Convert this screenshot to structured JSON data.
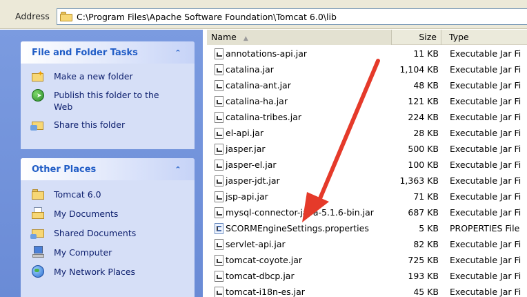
{
  "address_bar": {
    "label": "Address",
    "path": "C:\\Program Files\\Apache Software Foundation\\Tomcat 6.0\\lib",
    "icon": "folder-icon"
  },
  "file_folder_tasks": {
    "title": "File and Folder Tasks",
    "items": [
      {
        "label": "Make a new folder",
        "icon": "new-folder-icon"
      },
      {
        "label": "Publish this folder to the Web",
        "icon": "publish-web-icon"
      },
      {
        "label": "Share this folder",
        "icon": "share-folder-icon"
      }
    ]
  },
  "other_places": {
    "title": "Other Places",
    "items": [
      {
        "label": "Tomcat 6.0",
        "icon": "folder-icon"
      },
      {
        "label": "My Documents",
        "icon": "my-documents-icon"
      },
      {
        "label": "Shared Documents",
        "icon": "shared-folder-icon"
      },
      {
        "label": "My Computer",
        "icon": "my-computer-icon"
      },
      {
        "label": "My Network Places",
        "icon": "network-places-icon"
      }
    ]
  },
  "file_list": {
    "columns": {
      "name": "Name",
      "size": "Size",
      "type": "Type"
    },
    "files": [
      {
        "name": "annotations-api.jar",
        "size": "11 KB",
        "type": "Executable Jar Fi",
        "icon": "jar-file-icon"
      },
      {
        "name": "catalina.jar",
        "size": "1,104 KB",
        "type": "Executable Jar Fi",
        "icon": "jar-file-icon"
      },
      {
        "name": "catalina-ant.jar",
        "size": "48 KB",
        "type": "Executable Jar Fi",
        "icon": "jar-file-icon"
      },
      {
        "name": "catalina-ha.jar",
        "size": "121 KB",
        "type": "Executable Jar Fi",
        "icon": "jar-file-icon"
      },
      {
        "name": "catalina-tribes.jar",
        "size": "224 KB",
        "type": "Executable Jar Fi",
        "icon": "jar-file-icon"
      },
      {
        "name": "el-api.jar",
        "size": "28 KB",
        "type": "Executable Jar Fi",
        "icon": "jar-file-icon"
      },
      {
        "name": "jasper.jar",
        "size": "500 KB",
        "type": "Executable Jar Fi",
        "icon": "jar-file-icon"
      },
      {
        "name": "jasper-el.jar",
        "size": "100 KB",
        "type": "Executable Jar Fi",
        "icon": "jar-file-icon"
      },
      {
        "name": "jasper-jdt.jar",
        "size": "1,363 KB",
        "type": "Executable Jar Fi",
        "icon": "jar-file-icon"
      },
      {
        "name": "jsp-api.jar",
        "size": "71 KB",
        "type": "Executable Jar Fi",
        "icon": "jar-file-icon"
      },
      {
        "name": "mysql-connector-java-5.1.6-bin.jar",
        "size": "687 KB",
        "type": "Executable Jar Fi",
        "icon": "jar-file-icon"
      },
      {
        "name": "SCORMEngineSettings.properties",
        "size": "5 KB",
        "type": "PROPERTIES File",
        "icon": "properties-file-icon"
      },
      {
        "name": "servlet-api.jar",
        "size": "82 KB",
        "type": "Executable Jar Fi",
        "icon": "jar-file-icon"
      },
      {
        "name": "tomcat-coyote.jar",
        "size": "725 KB",
        "type": "Executable Jar Fi",
        "icon": "jar-file-icon"
      },
      {
        "name": "tomcat-dbcp.jar",
        "size": "193 KB",
        "type": "Executable Jar Fi",
        "icon": "jar-file-icon"
      },
      {
        "name": "tomcat-i18n-es.jar",
        "size": "45 KB",
        "type": "Executable Jar Fi",
        "icon": "jar-file-icon"
      }
    ]
  },
  "annotation": {
    "color": "#e53a2a",
    "icon": "red-arrow-annotation"
  }
}
